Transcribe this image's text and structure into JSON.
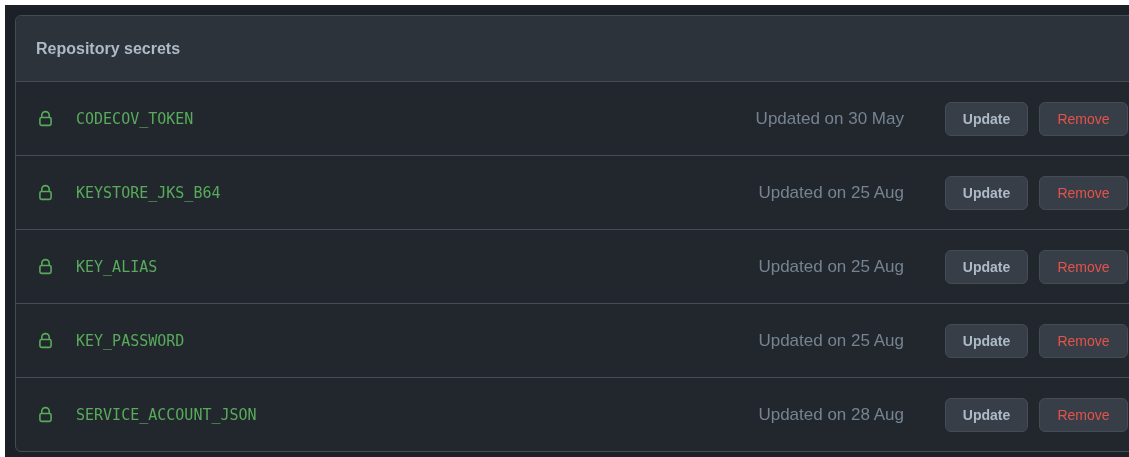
{
  "panel": {
    "title": "Repository secrets",
    "secrets": [
      {
        "name": "CODECOV_TOKEN",
        "updated": "Updated on 30 May",
        "update_label": "Update",
        "remove_label": "Remove"
      },
      {
        "name": "KEYSTORE_JKS_B64",
        "updated": "Updated on 25 Aug",
        "update_label": "Update",
        "remove_label": "Remove"
      },
      {
        "name": "KEY_ALIAS",
        "updated": "Updated on 25 Aug",
        "update_label": "Update",
        "remove_label": "Remove"
      },
      {
        "name": "KEY_PASSWORD",
        "updated": "Updated on 25 Aug",
        "update_label": "Update",
        "remove_label": "Remove"
      },
      {
        "name": "SERVICE_ACCOUNT_JSON",
        "updated": "Updated on 28 Aug",
        "update_label": "Update",
        "remove_label": "Remove"
      }
    ]
  }
}
